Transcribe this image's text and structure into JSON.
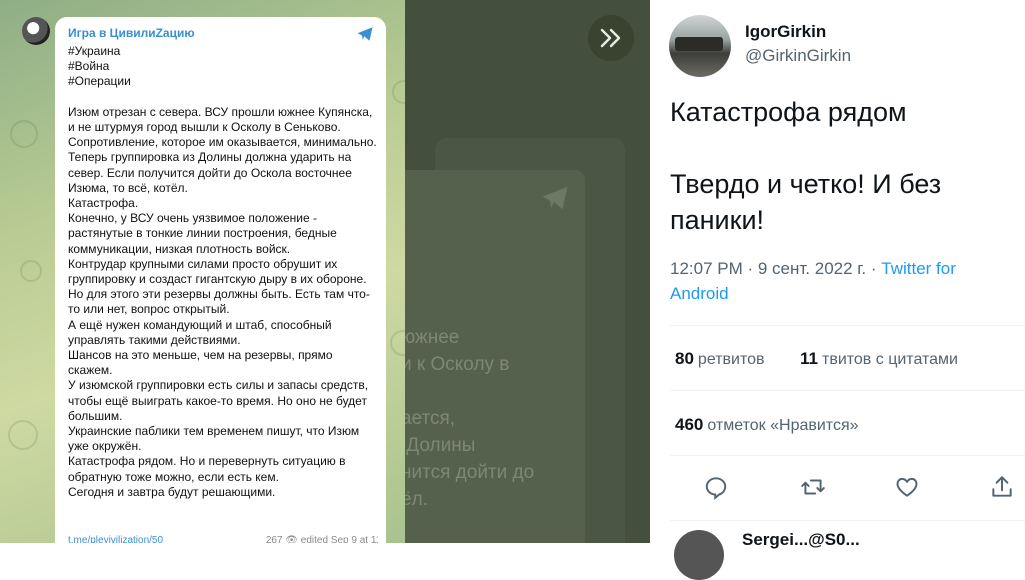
{
  "telegram": {
    "channel_name": "Игра в ЦивилиZацию",
    "message_text": "#Украина\n#Война\n#Операции\n\nИзюм отрезан с севера. ВСУ прошли южнее Купянска, и не штурмуя город вышли к Осколу в Сеньково.\nСопротивление, которое им оказывается, минимально. Теперь группировка из Долины должна ударить на север. Если получится дойти до Оскола восточнее Изюма, то всё, котёл.\nКатастрофа.\nКонечно, у ВСУ очень уязвимое положение - растянутые в тонкие линии построения, бедные коммуникации, низкая плотность войск.\nКонтрудар крупными силами просто обрушит их группировку и создаст гигантскую дыру в их обороне.\nНо для этого эти резервы должны быть. Есть там что-то или нет, вопрос открытый.\nА ещё нужен командующий и штаб, способный управлять такими действиями.\nШансов на это меньше, чем на резервы, прямо скажем.\nУ изюмской группировки есть силы и запасы средств, чтобы ещё выиграть какое-то время. Но оно не будет большим.\nУкраинские паблики тем временем пишут, что Изюм уже окружён.\nКатастрофа рядом. Но и перевернуть ситуацию в обратную тоже можно, если есть кем.\nСегодня и завтра будут решающими.",
    "footer_link": "t.me/pleyivilization/50",
    "footer_meta": "267 👁  edited  Sep 9 at 11:50"
  },
  "middle": {
    "ghost_text": "южнее\nи к Осколу в\n\nается,\n Долины\nнится дойти до\nёл."
  },
  "tweet": {
    "display_name": "IgorGirkin",
    "handle": "@GirkinGirkin",
    "body": "Катастрофа рядом\n\nТвердо и четко! И без паники!",
    "time_date": "12:07 PM · 9 сент. 2022 г. · ",
    "source": "Twitter for Android",
    "retweets_count": "80",
    "retweets_label": "ретвитов",
    "quotes_count": "11",
    "quotes_label": "твитов с цитатами",
    "likes_count": "460",
    "likes_label": "отметок «Нравится»",
    "next_reply_partial": "Sergei...@S0..."
  }
}
